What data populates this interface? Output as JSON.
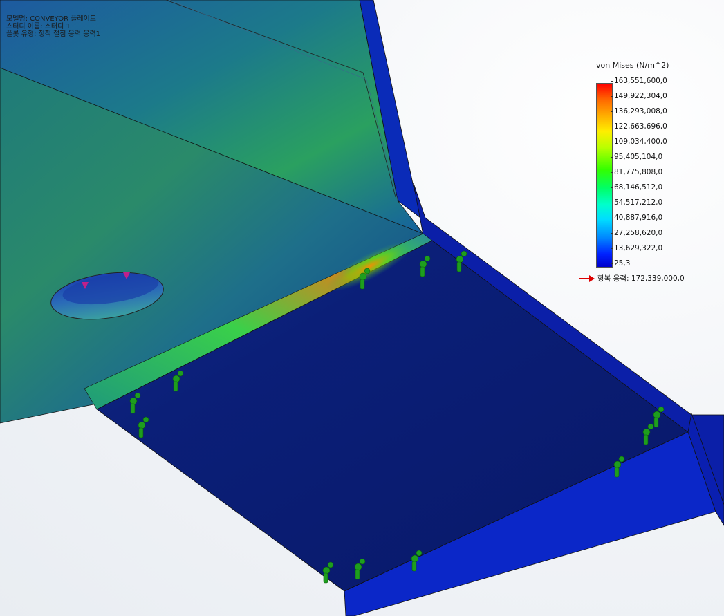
{
  "model_info": {
    "line1": "모델명: CONVEYOR 플레이트",
    "line2": "스터디 이름: 스터디 1",
    "line3": "플롯 유형: 정적 절점 응력 응력1"
  },
  "legend": {
    "title": "von Mises (N/m^2)",
    "ticks": [
      "163,551,600,0",
      "149,922,304,0",
      "136,293,008,0",
      "122,663,696,0",
      "109,034,400,0",
      "95,405,104,0",
      "81,775,808,0",
      "68,146,512,0",
      "54,517,212,0",
      "40,887,916,0",
      "27,258,620,0",
      "13,629,322,0",
      "25,3"
    ],
    "yield_label": "항복 응력: 172,339,000,0",
    "yield_arrow_color": "#dd0000"
  },
  "colors": {
    "high_stress": "#ff0000",
    "low_stress": "#00008b",
    "fixture": "#1e9e1e"
  },
  "icons": {
    "fixture": "fixed-geometry-icon",
    "load": "load-arrow-icon"
  }
}
